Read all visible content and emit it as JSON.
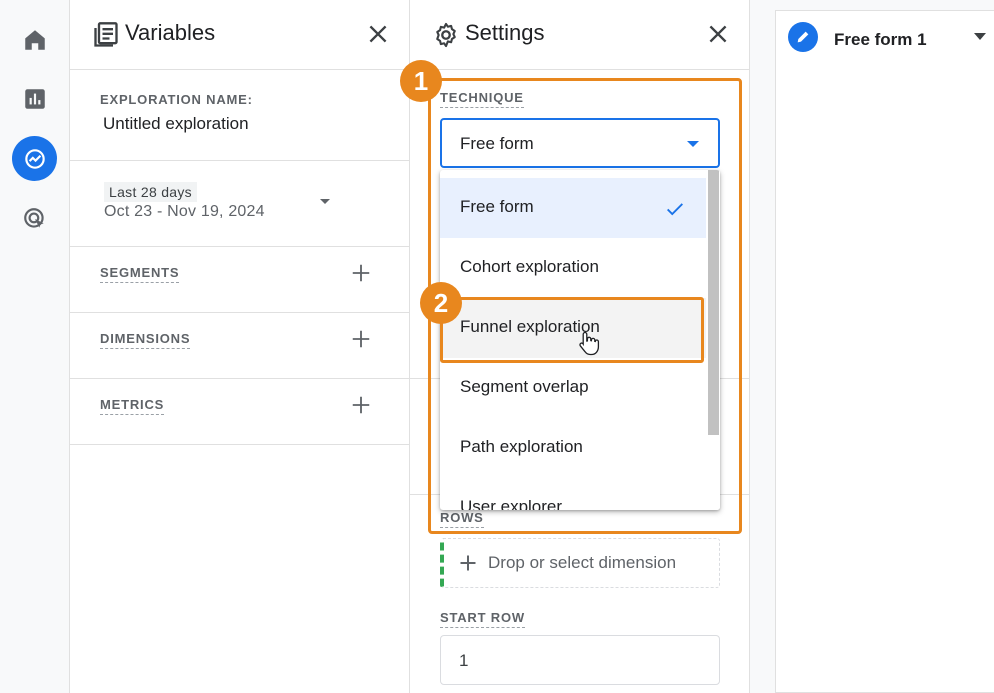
{
  "rail": {
    "items": [
      "home-icon",
      "reports-icon",
      "explore-icon",
      "advertising-icon"
    ],
    "active": "explore-icon"
  },
  "variables": {
    "title": "Variables",
    "exploration_name_label": "EXPLORATION NAME:",
    "exploration_name_value": "Untitled exploration",
    "date_chip": "Last 28 days",
    "date_range": "Oct 23 - Nov 19, 2024",
    "segments_label": "SEGMENTS",
    "dimensions_label": "DIMENSIONS",
    "metrics_label": "METRICS"
  },
  "settings": {
    "title": "Settings",
    "technique_label": "TECHNIQUE",
    "technique_value": "Free form",
    "rows_label": "ROWS",
    "drop_placeholder": "Drop or select dimension",
    "start_row_label": "START ROW",
    "start_row_value": "1"
  },
  "dropdown": {
    "options": [
      {
        "label": "Free form",
        "state": "selected"
      },
      {
        "label": "Cohort exploration",
        "state": "normal"
      },
      {
        "label": "Funnel exploration",
        "state": "hover"
      },
      {
        "label": "Segment overlap",
        "state": "normal"
      },
      {
        "label": "Path exploration",
        "state": "normal"
      },
      {
        "label": "User explorer",
        "state": "normal"
      }
    ]
  },
  "annotations": {
    "step1": "1",
    "step2": "2",
    "color": "#e8871e"
  },
  "tab": {
    "title": "Free form 1"
  },
  "colors": {
    "accent": "#1a73e8",
    "highlight": "#e8871e",
    "rows_indicator": "#34a853"
  }
}
